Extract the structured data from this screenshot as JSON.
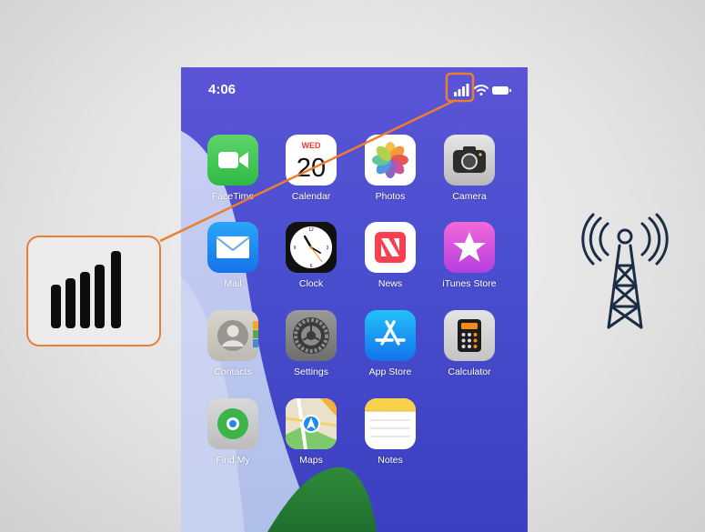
{
  "status_bar": {
    "time": "4:06"
  },
  "apps": [
    {
      "id": "facetime",
      "label": "FaceTime"
    },
    {
      "id": "calendar",
      "label": "Calendar",
      "weekday": "WED",
      "day": "20"
    },
    {
      "id": "photos",
      "label": "Photos"
    },
    {
      "id": "camera",
      "label": "Camera"
    },
    {
      "id": "mail",
      "label": "Mail"
    },
    {
      "id": "clock",
      "label": "Clock"
    },
    {
      "id": "news",
      "label": "News"
    },
    {
      "id": "itunes",
      "label": "iTunes Store"
    },
    {
      "id": "contacts",
      "label": "Contacts"
    },
    {
      "id": "settings",
      "label": "Settings"
    },
    {
      "id": "appstore",
      "label": "App Store"
    },
    {
      "id": "calculator",
      "label": "Calculator"
    },
    {
      "id": "findmy",
      "label": "Find My"
    },
    {
      "id": "maps",
      "label": "Maps"
    },
    {
      "id": "notes",
      "label": "Notes"
    }
  ],
  "annotations": {
    "callout_icon": "cellular-signal-bars-icon",
    "tower_icon": "cell-tower-icon",
    "highlight_color": "#ed7d31"
  },
  "colors": {
    "wallpaper_blue": "#4a4fd0",
    "wallpaper_light": "#b8c7ee",
    "accent_orange": "#ed7d31"
  }
}
